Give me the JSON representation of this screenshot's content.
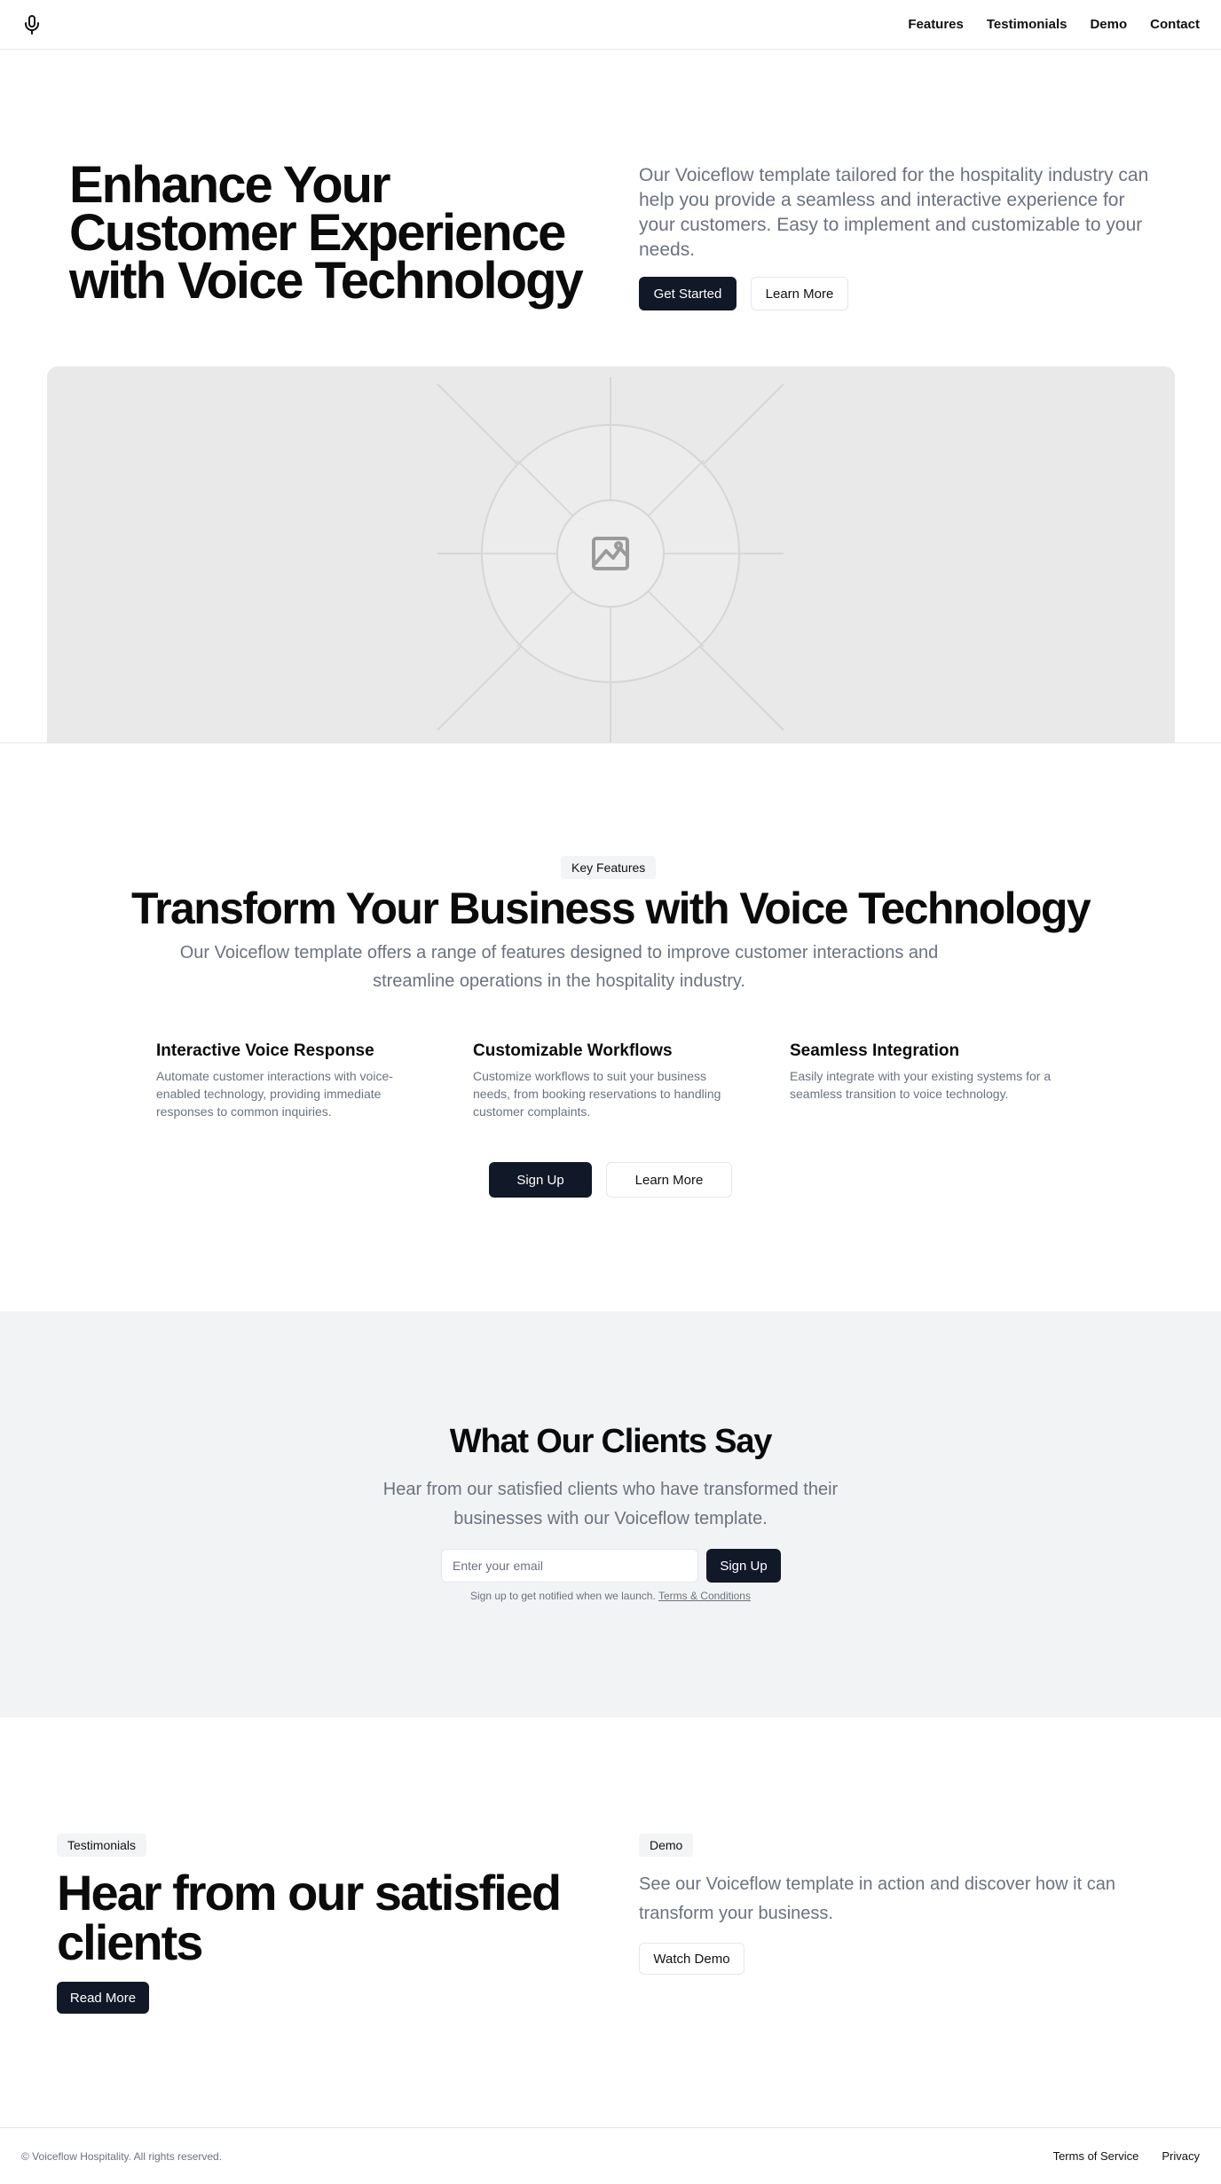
{
  "header": {
    "logo_icon": "microphone-icon",
    "nav": [
      "Features",
      "Testimonials",
      "Demo",
      "Contact"
    ]
  },
  "hero": {
    "title": "Enhance Your Customer Experience with Voice Technology",
    "description": "Our Voiceflow template tailored for the hospitality industry can help you provide a seamless and interactive experience for your customers. Easy to implement and customizable to your needs.",
    "primary_button": "Get Started",
    "secondary_button": "Learn More",
    "image_icon": "image-placeholder-icon"
  },
  "features": {
    "badge": "Key Features",
    "title": "Transform Your Business with Voice Technology",
    "description": "Our Voiceflow template offers a range of features designed to improve customer interactions and streamline operations in the hospitality industry.",
    "items": [
      {
        "title": "Interactive Voice Response",
        "text": "Automate customer interactions with voice-enabled technology, providing immediate responses to common inquiries."
      },
      {
        "title": "Customizable Workflows",
        "text": "Customize workflows to suit your business needs, from booking reservations to handling customer complaints."
      },
      {
        "title": "Seamless Integration",
        "text": "Easily integrate with your existing systems for a seamless transition to voice technology."
      }
    ],
    "primary_button": "Sign Up",
    "secondary_button": "Learn More"
  },
  "clients": {
    "title": "What Our Clients Say",
    "description": "Hear from our satisfied clients who have transformed their businesses with our Voiceflow template.",
    "email_placeholder": "Enter your email",
    "button": "Sign Up",
    "note": "Sign up to get notified when we launch.",
    "terms_link": "Terms & Conditions"
  },
  "testimonials": {
    "badge": "Testimonials",
    "title": "Hear from our satisfied clients",
    "button": "Read More"
  },
  "demo": {
    "badge": "Demo",
    "description": "See our Voiceflow template in action and discover how it can transform your business.",
    "button": "Watch Demo"
  },
  "footer": {
    "copyright": "© Voiceflow Hospitality. All rights reserved.",
    "links": [
      "Terms of Service",
      "Privacy"
    ]
  },
  "colors": {
    "primary_button": "#111827",
    "muted_text": "#6b7280",
    "section_bg": "#f2f3f5",
    "placeholder_bg": "#e9e9e9"
  }
}
